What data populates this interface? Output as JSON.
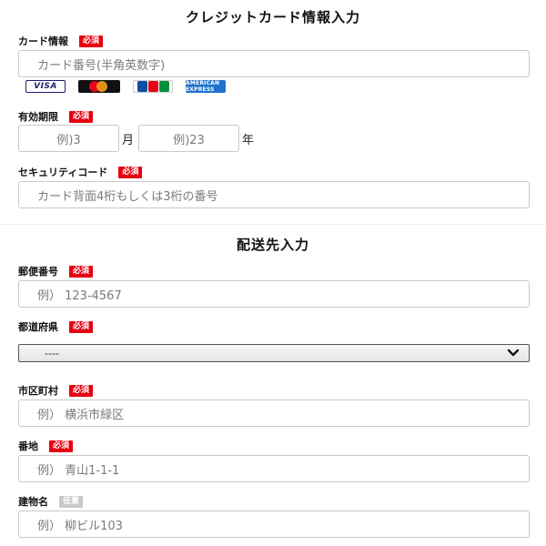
{
  "payment": {
    "title": "クレジットカード情報入力",
    "card_number": {
      "label": "カード情報",
      "required_badge": "必須",
      "placeholder": "カード番号(半角英数字)"
    },
    "card_brands": [
      {
        "name": "VISA",
        "text": "VISA"
      },
      {
        "name": "Mastercard",
        "text": ""
      },
      {
        "name": "JCB",
        "text": ""
      },
      {
        "name": "American Express",
        "text": "AMERICAN EXPRESS"
      }
    ],
    "expiry": {
      "label": "有効期限",
      "required_badge": "必須",
      "month_placeholder": "例)3",
      "month_unit": "月",
      "year_placeholder": "例)23",
      "year_unit": "年"
    },
    "security_code": {
      "label": "セキュリティコード",
      "required_badge": "必須",
      "placeholder": "カード背面4桁もしくは3桁の番号"
    }
  },
  "shipping": {
    "title": "配送先入力",
    "postal_code": {
      "label": "郵便番号",
      "required_badge": "必須",
      "placeholder": "例） 123-4567"
    },
    "prefecture": {
      "label": "都道府県",
      "required_badge": "必須",
      "selected": "----"
    },
    "city": {
      "label": "市区町村",
      "required_badge": "必須",
      "placeholder": "例） 横浜市緑区"
    },
    "address": {
      "label": "番地",
      "required_badge": "必須",
      "placeholder": "例） 青山1-1-1"
    },
    "building": {
      "label": "建物名",
      "optional_badge": "任意",
      "placeholder": "例） 柳ビル103"
    }
  },
  "colors": {
    "required_badge": "#e60012",
    "optional_badge": "#c8c8c8",
    "field_border": "#c9c9c9"
  }
}
